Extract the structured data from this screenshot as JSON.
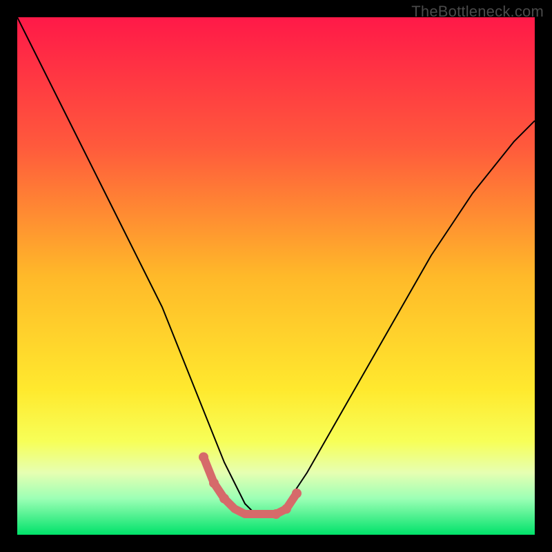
{
  "watermark": "TheBottleneck.com",
  "chart_data": {
    "type": "line",
    "title": "",
    "xlabel": "",
    "ylabel": "",
    "xlim": [
      0,
      100
    ],
    "ylim": [
      0,
      100
    ],
    "gradient_stops": [
      {
        "offset": 0,
        "color": "#ff1948"
      },
      {
        "offset": 25,
        "color": "#ff5a3c"
      },
      {
        "offset": 50,
        "color": "#ffb929"
      },
      {
        "offset": 72,
        "color": "#ffe92e"
      },
      {
        "offset": 82,
        "color": "#f7ff58"
      },
      {
        "offset": 88,
        "color": "#e6ffb2"
      },
      {
        "offset": 93,
        "color": "#9cffb5"
      },
      {
        "offset": 100,
        "color": "#00e26a"
      }
    ],
    "series": [
      {
        "name": "bottleneck-curve",
        "stroke": "#000000",
        "stroke_width": 2,
        "x": [
          0,
          4,
          8,
          12,
          16,
          20,
          24,
          28,
          30,
          32,
          34,
          36,
          38,
          40,
          42,
          44,
          46,
          48,
          50,
          52,
          56,
          60,
          64,
          68,
          72,
          76,
          80,
          84,
          88,
          92,
          96,
          100
        ],
        "y": [
          100,
          92,
          84,
          76,
          68,
          60,
          52,
          44,
          39,
          34,
          29,
          24,
          19,
          14,
          10,
          6,
          4,
          4,
          4,
          6,
          12,
          19,
          26,
          33,
          40,
          47,
          54,
          60,
          66,
          71,
          76,
          80
        ]
      },
      {
        "name": "bottom-highlight",
        "stroke": "#d66a6a",
        "stroke_width": 12,
        "linecap": "round",
        "x": [
          36,
          38,
          40,
          42,
          44,
          46,
          48,
          50,
          52,
          54
        ],
        "y": [
          15,
          10,
          7,
          5,
          4,
          4,
          4,
          4,
          5,
          8
        ]
      }
    ],
    "highlight_dots": {
      "color": "#d66a6a",
      "radius": 7,
      "points": [
        {
          "x": 36,
          "y": 15
        },
        {
          "x": 38,
          "y": 10
        },
        {
          "x": 40,
          "y": 7
        },
        {
          "x": 50,
          "y": 4
        },
        {
          "x": 52,
          "y": 5
        },
        {
          "x": 54,
          "y": 8
        }
      ]
    }
  }
}
